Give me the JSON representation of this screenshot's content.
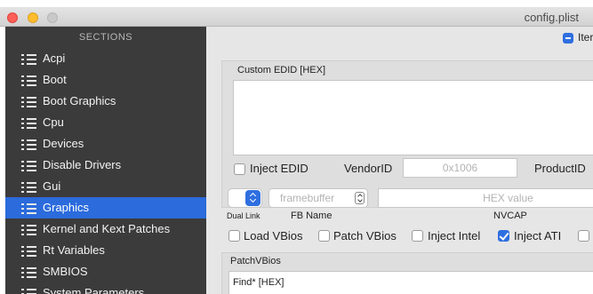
{
  "window": {
    "title": "config.plist"
  },
  "sidebar": {
    "heading": "SECTIONS",
    "items": [
      {
        "label": "Acpi"
      },
      {
        "label": "Boot"
      },
      {
        "label": "Boot Graphics"
      },
      {
        "label": "Cpu"
      },
      {
        "label": "Devices"
      },
      {
        "label": "Disable Drivers"
      },
      {
        "label": "Gui"
      },
      {
        "label": "Graphics",
        "selected": true
      },
      {
        "label": "Kernel and Kext Patches"
      },
      {
        "label": "Rt Variables"
      },
      {
        "label": "SMBIOS"
      },
      {
        "label": "System Parameters"
      }
    ]
  },
  "main": {
    "iter_label": "Iter",
    "iter_checked": true,
    "edid": {
      "title": "Custom EDID [HEX]",
      "value": "",
      "inject_edid_label": "Inject EDID",
      "inject_edid_checked": false,
      "vendor_label": "VendorID",
      "vendor_placeholder": "0x1006",
      "product_label": "ProductID"
    },
    "dual_link_label": "Dual Link",
    "fb_name_label": "FB Name",
    "fb_placeholder": "framebuffer",
    "nvcap_label": "NVCAP",
    "nvcap_placeholder": "HEX value",
    "checkboxes": [
      {
        "label": "Load VBios",
        "checked": false
      },
      {
        "label": "Patch VBios",
        "checked": false
      },
      {
        "label": "Inject Intel",
        "checked": false
      },
      {
        "label": "Inject ATI",
        "checked": true
      }
    ],
    "patch_vbios": {
      "title": "PatchVBios",
      "find_header": "Find* [HEX]"
    }
  }
}
